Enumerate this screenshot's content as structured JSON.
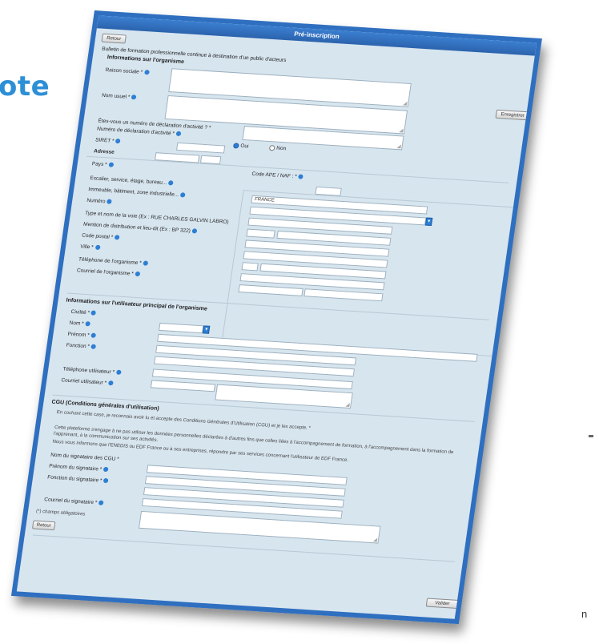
{
  "background": {
    "heading_fragment": "ote",
    "footer_fragment": "n"
  },
  "window": {
    "title": "Pré-inscription",
    "top_left_button": "Retour",
    "right_button": "Enregistrer",
    "bottom_left_button": "Retour",
    "bottom_right_button": "Valider"
  },
  "intro": "Bulletin de formation professionnelle continue à destination d'un public d'acteurs",
  "org_section": {
    "title": "Informations sur l'organisme",
    "raison_sociale": "Raison sociale *",
    "nom_usuel": "Nom usuel *",
    "declarant_question": "Êtes-vous un numéro de déclaration d'activité ? *",
    "declaration_num": "Numéro de déclaration d'activité *",
    "radio_yes": "Oui",
    "radio_no": "Non",
    "siret": "SIRET *",
    "adresse": "Adresse",
    "pays": "Pays *",
    "code_ape": "Code APE / NAF : *",
    "etage": "Escalier, service, étage, bureau...",
    "immeuble": "Immeuble, bâtiment, zone industrielle...",
    "numero": "Numéro",
    "type_voie": "Type et nom de la voie (Ex : RUE CHARLES GALVIN LABRO)",
    "mention": "Mention de distribution et lieu-dit (Ex : BP 322)",
    "code_postal": "Code postal *",
    "ville": "Ville *",
    "telephone": "Téléphone de l'organisme *",
    "courriel": "Courriel de l'organisme *",
    "country_value": "FRANCE"
  },
  "user_section": {
    "title": "Informations sur l'utilisateur principal de l'organisme",
    "civilite": "Civilité *",
    "nom": "Nom *",
    "prenom": "Prénom *",
    "fonction": "Fonction *",
    "tel_user": "Téléphone utilisateur *",
    "courriel_user": "Courriel utilisateur *"
  },
  "cgu_section": {
    "title": "CGU (Conditions générales d'utilisation)",
    "accept_line": "En cochant cette case, je reconnais avoir lu et accepte des Conditions Générales d'Utilisation (CGU) et je les accepte. *",
    "cgu_link": "Conditions Générales d'Utilisation (CGU)",
    "para1": "Cette plateforme s'engage à ne pas utiliser les données personnelles déclarées à d'autres fins que celles liées à l'accompagnement de formation, à l'accompagnement dans la formation de l'apprenant, à la communication sur ses activités.",
    "para2": "Nous vous informons que l'ENEDIS ou EDF France ou à ses entreprises, répondre par ses services concernant l'utilisateur de EDF France.",
    "signataire_cgu": "Nom du signataire des CGU *",
    "prenom_sig": "Prénom du signataire *",
    "fonction_sig": "Fonction du signataire *",
    "courriel_sig": "Courriel du signataire *",
    "mandatory": "(*) champs obligatoires"
  }
}
